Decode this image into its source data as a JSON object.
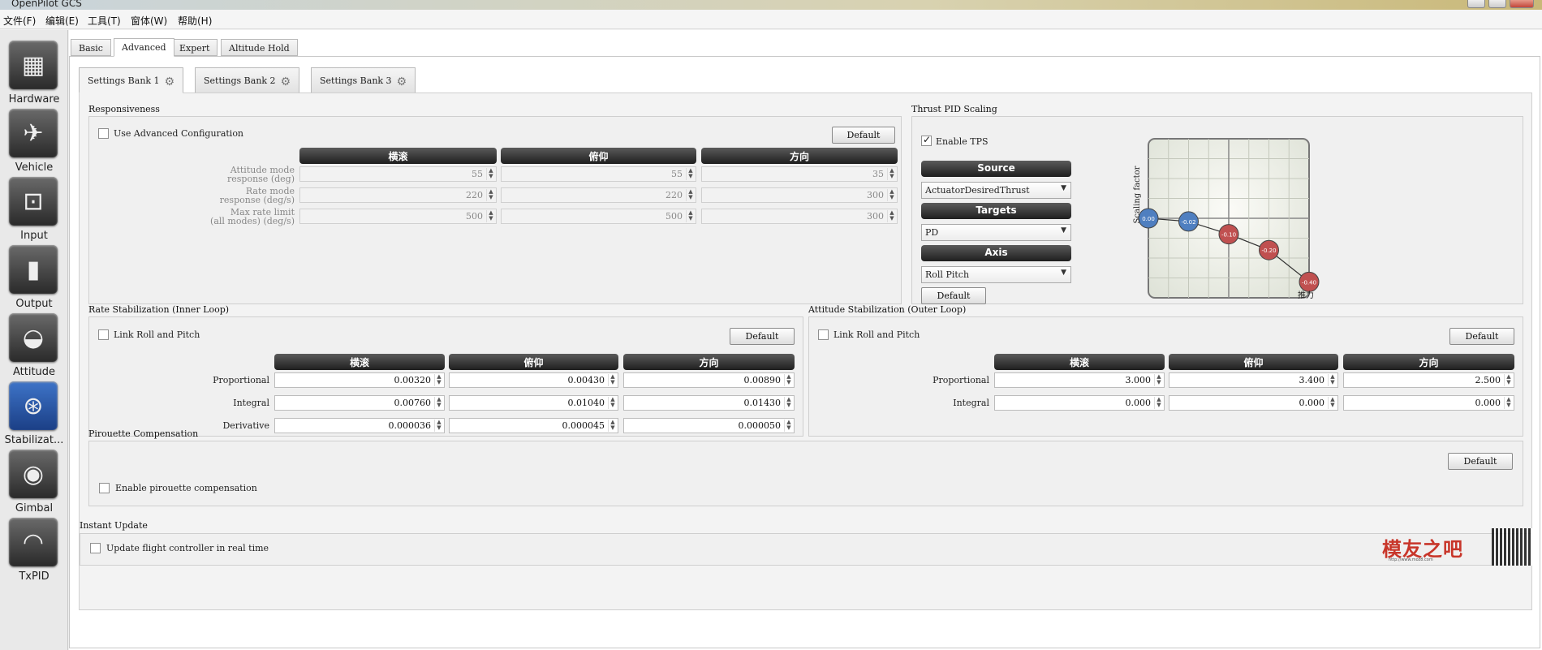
{
  "window": {
    "title": "OpenPilot GCS"
  },
  "menu": [
    "文件(F)",
    "编辑(E)",
    "工具(T)",
    "窗体(W)",
    "帮助(H)"
  ],
  "sidebar": {
    "items": [
      {
        "label": "Hardware",
        "icon": "chip-icon"
      },
      {
        "label": "Vehicle",
        "icon": "aircraft-icon"
      },
      {
        "label": "Input",
        "icon": "transmitter-icon"
      },
      {
        "label": "Output",
        "icon": "motor-icon"
      },
      {
        "label": "Attitude",
        "icon": "horizon-icon"
      },
      {
        "label": "Stabilizat...",
        "icon": "gyro-icon"
      },
      {
        "label": "Gimbal",
        "icon": "camera-icon"
      },
      {
        "label": "TxPID",
        "icon": "meter-icon"
      }
    ]
  },
  "tabs": [
    "Basic",
    "Advanced",
    "Expert",
    "Altitude Hold"
  ],
  "bank_tabs": [
    "Settings Bank 1",
    "Settings Bank 2",
    "Settings Bank 3"
  ],
  "responsiveness": {
    "title": "Responsiveness",
    "use_advanced": "Use Advanced Configuration",
    "default": "Default",
    "columns": [
      "横滚",
      "俯仰",
      "方向"
    ],
    "rows": [
      {
        "label1": "Attitude mode",
        "label2": "response (deg)",
        "values": [
          "55",
          "55",
          "35"
        ]
      },
      {
        "label1": "Rate mode",
        "label2": "response (deg/s)",
        "values": [
          "220",
          "220",
          "300"
        ]
      },
      {
        "label1": "Max rate limit",
        "label2": "(all modes) (deg/s)",
        "values": [
          "500",
          "500",
          "300"
        ]
      }
    ]
  },
  "tps": {
    "title": "Thrust PID Scaling",
    "enable": "Enable TPS",
    "source_hdr": "Source",
    "source_value": "ActuatorDesiredThrust",
    "targets_hdr": "Targets",
    "targets_value": "PD",
    "axis_hdr": "Axis",
    "axis_value": "Roll Pitch",
    "default": "Default"
  },
  "chart_data": {
    "type": "line",
    "ylabel": "Scaling factor",
    "xlabel": "推力",
    "xlim": [
      0,
      1
    ],
    "ylim": [
      -0.5,
      0.5
    ],
    "x": [
      0,
      0.25,
      0.5,
      0.75,
      1.0
    ],
    "values": [
      0.0,
      -0.02,
      -0.1,
      -0.2,
      -0.4
    ],
    "point_labels": [
      "0.00",
      "-0.02",
      "-0.10",
      "-0.20",
      "-0.40"
    ],
    "colors": [
      "#4f7fc0",
      "#4f7fc0",
      "#c05050",
      "#c05050",
      "#c05050"
    ],
    "grid": true
  },
  "rate_stab": {
    "title": "Rate Stabilization (Inner Loop)",
    "link": "Link Roll and Pitch",
    "default": "Default",
    "columns": [
      "横滚",
      "俯仰",
      "方向"
    ],
    "rows": [
      {
        "label": "Proportional",
        "values": [
          "0.00320",
          "0.00430",
          "0.00890"
        ]
      },
      {
        "label": "Integral",
        "values": [
          "0.00760",
          "0.01040",
          "0.01430"
        ]
      },
      {
        "label": "Derivative",
        "values": [
          "0.000036",
          "0.000045",
          "0.000050"
        ]
      }
    ]
  },
  "att_stab": {
    "title": "Attitude Stabilization (Outer Loop)",
    "link": "Link Roll and Pitch",
    "default": "Default",
    "columns": [
      "横滚",
      "俯仰",
      "方向"
    ],
    "rows": [
      {
        "label": "Proportional",
        "values": [
          "3.000",
          "3.400",
          "2.500"
        ]
      },
      {
        "label": "Integral",
        "values": [
          "0.000",
          "0.000",
          "0.000"
        ]
      }
    ]
  },
  "pirouette": {
    "title": "Pirouette Compensation",
    "default": "Default",
    "enable": "Enable pirouette compensation"
  },
  "instant": {
    "title": "Instant Update",
    "update": "Update flight controller in real time"
  },
  "watermark": {
    "text": "模友之吧",
    "url": "http://www.moz8.com"
  }
}
